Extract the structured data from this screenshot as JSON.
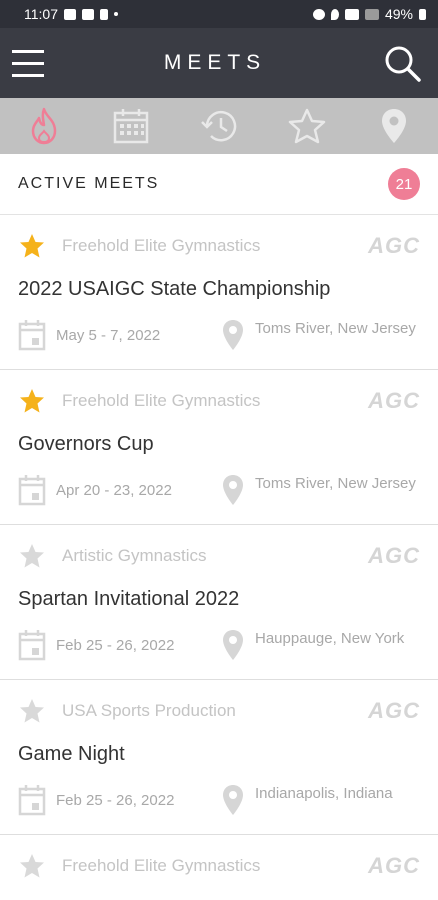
{
  "status": {
    "time": "11:07",
    "battery": "49%"
  },
  "appbar": {
    "title": "MEETS"
  },
  "tabs": [
    {
      "icon": "flame-icon",
      "active": true
    },
    {
      "icon": "calendar-icon",
      "active": false
    },
    {
      "icon": "history-icon",
      "active": false
    },
    {
      "icon": "star-icon",
      "active": false
    },
    {
      "icon": "location-pin-icon",
      "active": false
    }
  ],
  "section": {
    "label": "ACTIVE MEETS",
    "count": "21"
  },
  "logo_text": "AGC",
  "meets": [
    {
      "org": "Freehold Elite Gymnastics",
      "name": "2022 USAIGC State Championship",
      "date": "May 5 - 7, 2022",
      "location": "Toms River, New Jersey",
      "favorite": true
    },
    {
      "org": "Freehold Elite Gymnastics",
      "name": "Governors Cup",
      "date": "Apr 20 - 23, 2022",
      "location": "Toms River, New Jersey",
      "favorite": true
    },
    {
      "org": "Artistic Gymnastics",
      "name": "Spartan Invitational 2022",
      "date": "Feb 25 - 26, 2022",
      "location": "Hauppauge, New York",
      "favorite": false
    },
    {
      "org": "USA Sports Production",
      "name": "Game Night",
      "date": "Feb 25 - 26, 2022",
      "location": "Indianapolis, Indiana",
      "favorite": false
    },
    {
      "org": "Freehold Elite Gymnastics",
      "favorite": false
    }
  ],
  "colors": {
    "favorite": "#f5b21b",
    "unfavorite": "#d9d9d9",
    "accent": "#ef7e96"
  }
}
